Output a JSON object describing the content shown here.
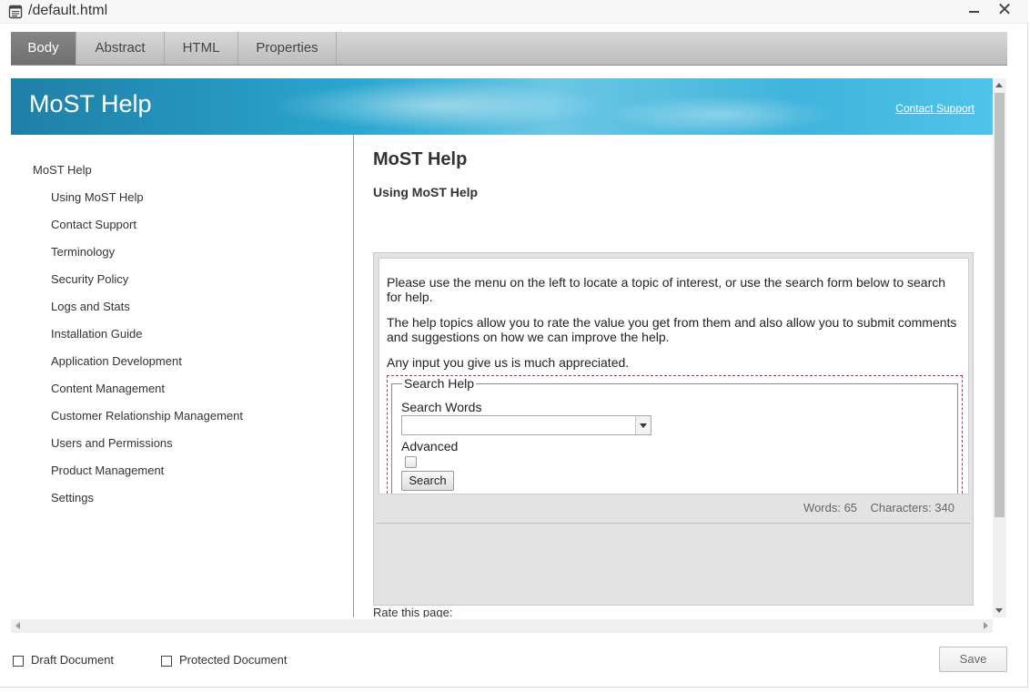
{
  "window": {
    "title": "/default.html",
    "icon": "document-icon"
  },
  "tabs": [
    {
      "label": "Body",
      "active": true
    },
    {
      "label": "Abstract",
      "active": false
    },
    {
      "label": "HTML",
      "active": false
    },
    {
      "label": "Properties",
      "active": false
    }
  ],
  "banner": {
    "title": "MoST Help",
    "contact_link": "Contact Support"
  },
  "nav": {
    "root": "MoST Help",
    "items": [
      "Using MoST Help",
      "Contact Support",
      "Terminology",
      "Security Policy",
      "Logs and Stats",
      "Installation Guide",
      "Application Development",
      "Content Management",
      "Customer Relationship Management",
      "Users and Permissions",
      "Product Management",
      "Settings"
    ]
  },
  "main": {
    "heading": "MoST Help",
    "subheading": "Using MoST Help",
    "rate_label": "Rate this page:"
  },
  "editor": {
    "paragraphs": [
      "Please use the menu on the left to locate a topic of interest, or use the search form below to search for help.",
      "The help topics allow you to rate the value you get from them and also allow you to submit comments and suggestions on how we can improve the help.",
      "Any input you give us is much appreciated."
    ],
    "search_form": {
      "legend": "Search Help",
      "words_label": "Search Words",
      "words_value": "",
      "advanced_label": "Advanced",
      "advanced_checked": false,
      "button_label": "Search"
    },
    "status": {
      "words": "Words: 65",
      "characters": "Characters: 340"
    }
  },
  "footer": {
    "draft_label": "Draft Document",
    "draft_checked": false,
    "protected_label": "Protected Document",
    "protected_checked": false,
    "save_label": "Save"
  },
  "colors": {
    "banner_start": "#1f7fa6",
    "banner_end": "#4fc4ea",
    "active_tab": "#787878",
    "search_region_border": "#b23a48"
  }
}
